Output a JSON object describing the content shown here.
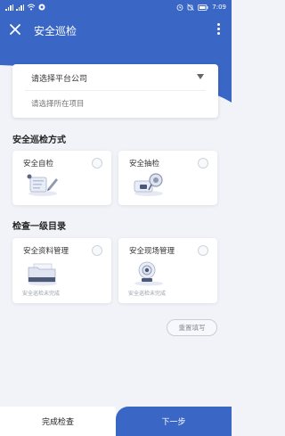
{
  "status_bar": {
    "time": "7:09",
    "left_icons": [
      "signal-icon",
      "signal-icon",
      "wifi-icon",
      "app-icon"
    ],
    "right_icons": [
      "alarm-icon",
      "mute-icon",
      "battery-icon"
    ]
  },
  "app_bar": {
    "title": "安全巡检",
    "close_icon": "close-icon",
    "more_icon": "more-vertical-icon",
    "color": "#3a67c6"
  },
  "selectors": {
    "platform_company": "请选择平台公司",
    "project": "请选择所在项目"
  },
  "inspection_method": {
    "title": "安全巡检方式",
    "options": [
      {
        "label": "安全自检",
        "icon": "self-check-icon"
      },
      {
        "label": "安全抽检",
        "icon": "spot-check-icon"
      }
    ]
  },
  "catalog": {
    "title": "检查一级目录",
    "items": [
      {
        "label": "安全资料管理",
        "icon": "folder-icon",
        "status": "安全巡检未完成"
      },
      {
        "label": "安全现场管理",
        "icon": "camera-icon",
        "status": "安全巡检未完成"
      }
    ]
  },
  "actions": {
    "reset": "重置填写",
    "complete": "完成检查",
    "next": "下一步"
  }
}
